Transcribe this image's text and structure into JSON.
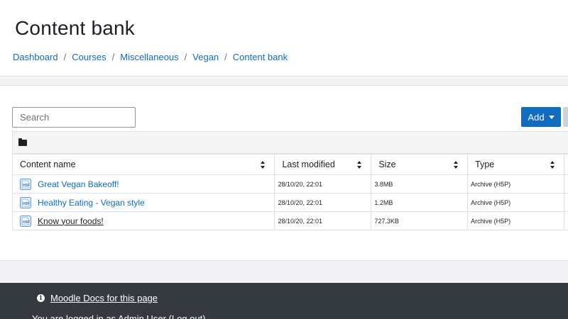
{
  "header": {
    "title": "Content bank",
    "breadcrumb": [
      {
        "label": "Dashboard"
      },
      {
        "label": "Courses"
      },
      {
        "label": "Miscellaneous"
      },
      {
        "label": "Vegan"
      },
      {
        "label": "Content bank"
      }
    ]
  },
  "toolbar": {
    "search_placeholder": "Search",
    "add_label": "Add"
  },
  "folder": {
    "icon": "folder-icon"
  },
  "table": {
    "columns": [
      "Content name",
      "Last modified",
      "Size",
      "Type"
    ],
    "rows": [
      {
        "name": "Great Vegan Bakeoff!",
        "modified": "28/10/20, 22:01",
        "size": "3.8MB",
        "type": "Archive (H5P)"
      },
      {
        "name": "Healthy Eating - Vegan style",
        "modified": "28/10/20, 22:01",
        "size": "1.2MB",
        "type": "Archive (H5P)"
      },
      {
        "name": "Know your foods!",
        "modified": "28/10/20, 22:01",
        "size": "727.3KB",
        "type": "Archive (H5P)"
      }
    ]
  },
  "footer": {
    "docs_label": "Moodle Docs for this page",
    "login_prefix": "You are logged in as ",
    "user_name": "Admin User",
    "logout_label": "(Log out)"
  },
  "colors": {
    "accent": "#0f6cbf",
    "footer_bg": "#343a40"
  }
}
